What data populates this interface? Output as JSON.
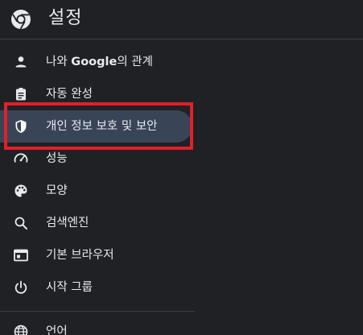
{
  "header": {
    "title": "설정",
    "logo_icon": "chrome-logo-icon"
  },
  "nav": {
    "items": [
      {
        "label_prefix": "나와 ",
        "label_bold": "Google",
        "label_suffix": "의 관계",
        "icon": "person-icon",
        "active": false
      },
      {
        "label": "자동 완성",
        "icon": "clipboard-icon",
        "active": false
      },
      {
        "label": "개인 정보 보호 및 보안",
        "icon": "shield-icon",
        "active": true
      },
      {
        "label": "성능",
        "icon": "speedometer-icon",
        "active": false
      },
      {
        "label": "모양",
        "icon": "palette-icon",
        "active": false
      },
      {
        "label": "검색엔진",
        "icon": "search-icon",
        "active": false
      },
      {
        "label": "기본 브라우저",
        "icon": "browser-window-icon",
        "active": false
      },
      {
        "label": "시작 그룹",
        "icon": "power-icon",
        "active": false
      },
      {
        "label": "언어",
        "icon": "globe-icon",
        "active": false
      }
    ]
  },
  "colors": {
    "background": "#202124",
    "active_item": "#394457",
    "text": "#e8eaed",
    "icon": "#e8eaed",
    "highlight_border": "#e0202a"
  }
}
